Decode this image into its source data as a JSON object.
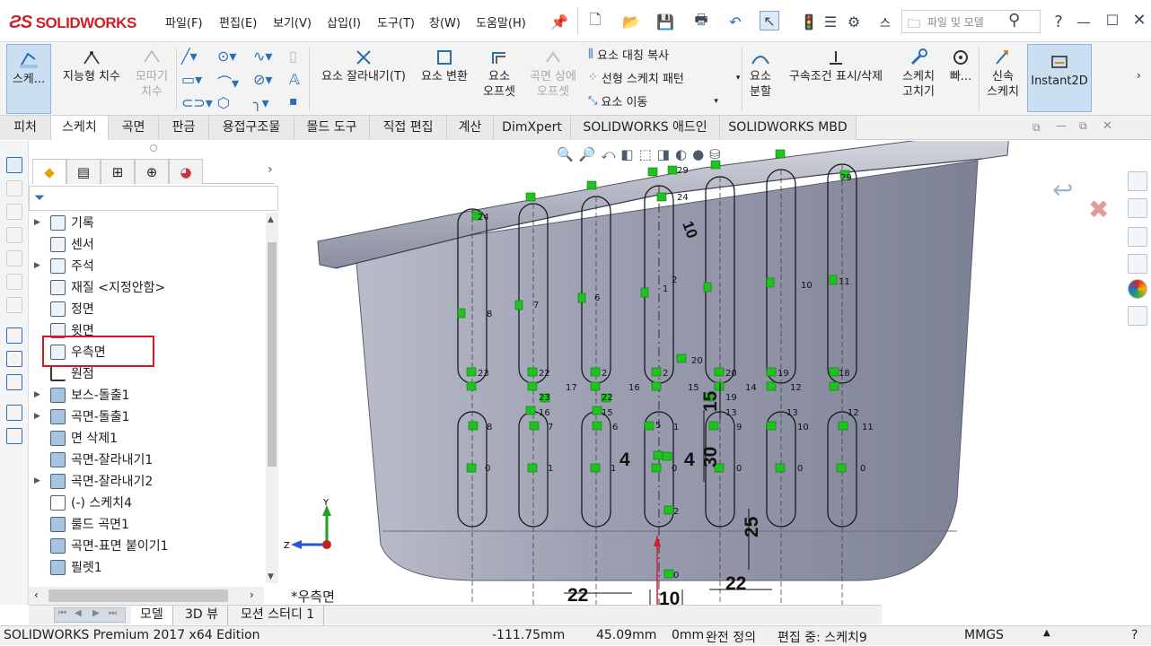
{
  "app": {
    "brand": "SOLIDWORKS",
    "menu": [
      "파일(F)",
      "편집(E)",
      "보기(V)",
      "삽입(I)",
      "도구(T)",
      "창(W)",
      "도움말(H)"
    ],
    "search_placeholder": "파일 및 모델",
    "ellipsis": "스"
  },
  "commands": {
    "sketch": "스케...",
    "smart_dimension": "지능형 치수",
    "trace": [
      "모따기",
      "치수"
    ],
    "trim": "요소 잘라내기(T)",
    "convert": "요소 변환",
    "offset": [
      "요소",
      "오프셋"
    ],
    "offset_surface": [
      "곡면 상에",
      "오프셋"
    ],
    "mirror": "요소 대칭 복사",
    "pattern": "선형 스케치 패턴",
    "move": "요소 이동",
    "split": [
      "요소",
      "분할"
    ],
    "relations": "구속조건 표시/삭제",
    "repair": [
      "스케치",
      "고치기"
    ],
    "quick": "빠...",
    "rapid": [
      "신속",
      "스케치"
    ],
    "instant2d": "Instant2D"
  },
  "tabs": [
    "피처",
    "스케치",
    "곡면",
    "판금",
    "용접구조물",
    "몰드 도구",
    "직접 편집",
    "계산",
    "DimXpert",
    "SOLIDWORKS 애드인",
    "SOLIDWORKS MBD"
  ],
  "active_tab": "스케치",
  "tree": [
    {
      "label": "기록",
      "arrow": true
    },
    {
      "label": "센서",
      "arrow": false
    },
    {
      "label": "주석",
      "arrow": true
    },
    {
      "label": "재질 <지정안함>",
      "arrow": false
    },
    {
      "label": "정면",
      "arrow": false
    },
    {
      "label": "윗면",
      "arrow": false
    },
    {
      "label": "우측면",
      "arrow": false
    },
    {
      "label": "원점",
      "arrow": false
    },
    {
      "label": "보스-돌출1",
      "arrow": true
    },
    {
      "label": "곡면-돌출1",
      "arrow": true
    },
    {
      "label": "면 삭제1",
      "arrow": false
    },
    {
      "label": "곡면-잘라내기1",
      "arrow": false
    },
    {
      "label": "곡면-잘라내기2",
      "arrow": true
    },
    {
      "label": "(-) 스케치4",
      "arrow": false
    },
    {
      "label": "룰드 곡면1",
      "arrow": false
    },
    {
      "label": "곡면-표면 붙이기1",
      "arrow": false
    },
    {
      "label": "필렛1",
      "arrow": false
    }
  ],
  "viewport": {
    "view_label": "*우측면",
    "dimensions": [
      "22",
      "22",
      "10",
      "25",
      "30",
      "15",
      "4",
      "4",
      "10"
    ],
    "axis_y": "Y",
    "axis_z": "Z"
  },
  "bottom_tabs": [
    "모델",
    "3D 뷰",
    "모션 스터디 1"
  ],
  "status": {
    "edition": "SOLIDWORKS Premium 2017 x64 Edition",
    "x": "-111.75mm",
    "y": "45.09mm",
    "z": "0mm",
    "state": "완전 정의",
    "editing": "편집 중: 스케치9",
    "units": "MMGS"
  },
  "colors": {
    "accent": "#e0141e",
    "relation": "#1fc21f",
    "brand": "#d21f27"
  }
}
